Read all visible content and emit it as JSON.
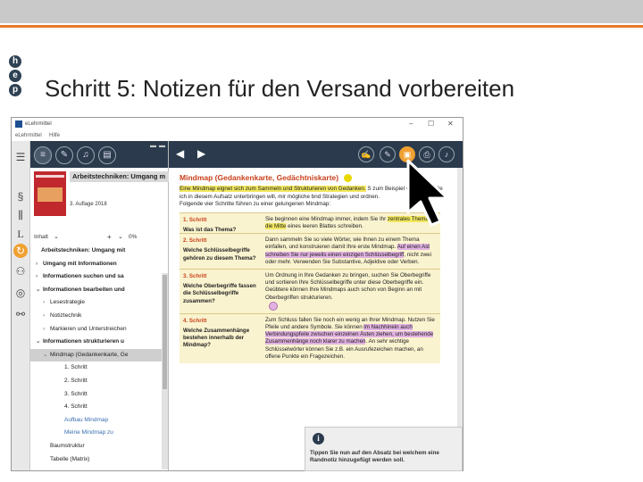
{
  "slide": {
    "logo_letters": [
      "h",
      "e",
      "p"
    ],
    "title": "Schritt 5: Notizen für den Versand vorbereiten"
  },
  "window": {
    "title": "eLehrmittel",
    "menu": [
      "eLehrmittel",
      "Hilfe"
    ],
    "controls": [
      "–",
      "☐",
      "✕"
    ]
  },
  "rail_icons": [
    "list-icon",
    "paragraph-icon",
    "stats-icon",
    "dictionary-icon",
    "sync-icon",
    "network-icon",
    "globe-icon",
    "share-icon"
  ],
  "sidebar": {
    "book_header": "Arbeitstechniken: Umgang m",
    "edition": "3. Auflage 2018",
    "content_label": "Inhalt",
    "zoom_value": "0%",
    "tree": [
      {
        "label": "Arbeitstechniken: Umgang mit",
        "indent": 0,
        "bold": true,
        "caret": ""
      },
      {
        "label": "Umgang mit Informationen",
        "indent": 1,
        "bold": true,
        "caret": "›"
      },
      {
        "label": "Informationen suchen und sa",
        "indent": 1,
        "bold": true,
        "caret": "›"
      },
      {
        "label": "Informationen bearbeiten und",
        "indent": 1,
        "bold": true,
        "caret": "⌄"
      },
      {
        "label": "Lesestrategie",
        "indent": 2,
        "bold": false,
        "caret": "›"
      },
      {
        "label": "Notiztechnik",
        "indent": 2,
        "bold": false,
        "caret": "›"
      },
      {
        "label": "Markieren und Unterstreichen",
        "indent": 2,
        "bold": false,
        "caret": "›"
      },
      {
        "label": "Informationen strukturieren u",
        "indent": 1,
        "bold": true,
        "caret": "⌄"
      },
      {
        "label": "Mindmap (Gedankenkarte, Ge",
        "indent": 2,
        "bold": false,
        "caret": "⌄",
        "selected": true
      },
      {
        "label": "1. Schritt",
        "indent": 3,
        "bold": false,
        "caret": ""
      },
      {
        "label": "2. Schritt",
        "indent": 3,
        "bold": false,
        "caret": ""
      },
      {
        "label": "3. Schritt",
        "indent": 3,
        "bold": false,
        "caret": ""
      },
      {
        "label": "4. Schritt",
        "indent": 3,
        "bold": false,
        "caret": ""
      },
      {
        "label": "Aufbau Mindmap",
        "indent": 3,
        "bold": false,
        "caret": "",
        "blue": true
      },
      {
        "label": "Meine Mindmap zu",
        "indent": 3,
        "bold": false,
        "caret": "",
        "blue": true
      },
      {
        "label": "Baumstruktur",
        "indent": 2,
        "bold": false,
        "caret": ""
      },
      {
        "label": "Tabelle (Matrix)",
        "indent": 2,
        "bold": false,
        "caret": ""
      }
    ]
  },
  "toolbar": {
    "back": "◀",
    "forward": "▶",
    "tools": [
      "draw-icon",
      "pen-icon",
      "note-icon",
      "print-icon",
      "audio-icon"
    ]
  },
  "document": {
    "title": "Mindmap (Gedankenkarte, Gedächtniskarte)",
    "intro_hl": "Eine Mindmap eignet sich zum Sammeln und Strukturieren von Gedanken.",
    "intro_rest": " S zum Beispiel Gedanken, die ich in diesem Aufsatz unterbringen will, mir mögliche bnd Strategien und ordnen.",
    "intro_tail": "Folgende vier Schritte führen zu einer gelungenen Mindmap:",
    "steps": [
      {
        "num": "1. Schritt",
        "q": "Was ist das Thema?",
        "t1": "Sie beginnen eine Mindmap immer, indem Sie Ihr ",
        "h1": "zentrales Thema in die Mitte",
        "t2": " eines leeren Blattes schreiben."
      },
      {
        "num": "2. Schritt",
        "q": "Welche Schlüsselbegriffe gehören zu diesem Thema?",
        "t1": "Dann sammeln Sie so viele Wörter, wie Ihnen zu einem Thema einfallen, und konstruieren damit Ihre erste Mindmap. ",
        "h1": "Auf einen Ast schreiben Sie nur jeweils einen einzigen Schlüsselbegriff",
        "t2": ", nicht zwei oder mehr. Verwenden Sie Substantive, Adjektive oder Verben."
      },
      {
        "num": "3. Schritt",
        "q": "Welche Oberbegriffe fassen die Schlüsselbegriffe zusammen?",
        "t1": "Um Ordnung in Ihre Gedanken zu bringen, suchen Sie Oberbegriffe und sortieren Ihre Schlüsselbegriffe unter diese Oberbegriffe ein. Geübtere können Ihre Mindmaps auch schon von Beginn an mit Oberbegriffen strukturieren.",
        "h1": "",
        "t2": ""
      },
      {
        "num": "4. Schritt",
        "q": "Welche Zusammenhänge bestehen innerhalb der Mindmap?",
        "t1": "Zum Schluss fallen Sie noch ein wenig an Ihrer Mindmap. Nutzen Sie Pfeile und andere Symbole. Sie können ",
        "h1": "im Nachhinein auch Verbindungspfeile zwischen einzelnen Ästen ziehen, um bestehende Zusammenhänge noch klarer zu machen",
        "t2": ". An sehr wichtige Schlüsselwörter können Sie z.B. ein Ausrufezeichen machen, an offene Punkte ein Fragezeichen."
      }
    ]
  },
  "tooltip": {
    "icon": "i",
    "message": "Tippen Sie nun auf den Absatz bei welchem eine Randnotiz hinzugefügt werden soll."
  }
}
